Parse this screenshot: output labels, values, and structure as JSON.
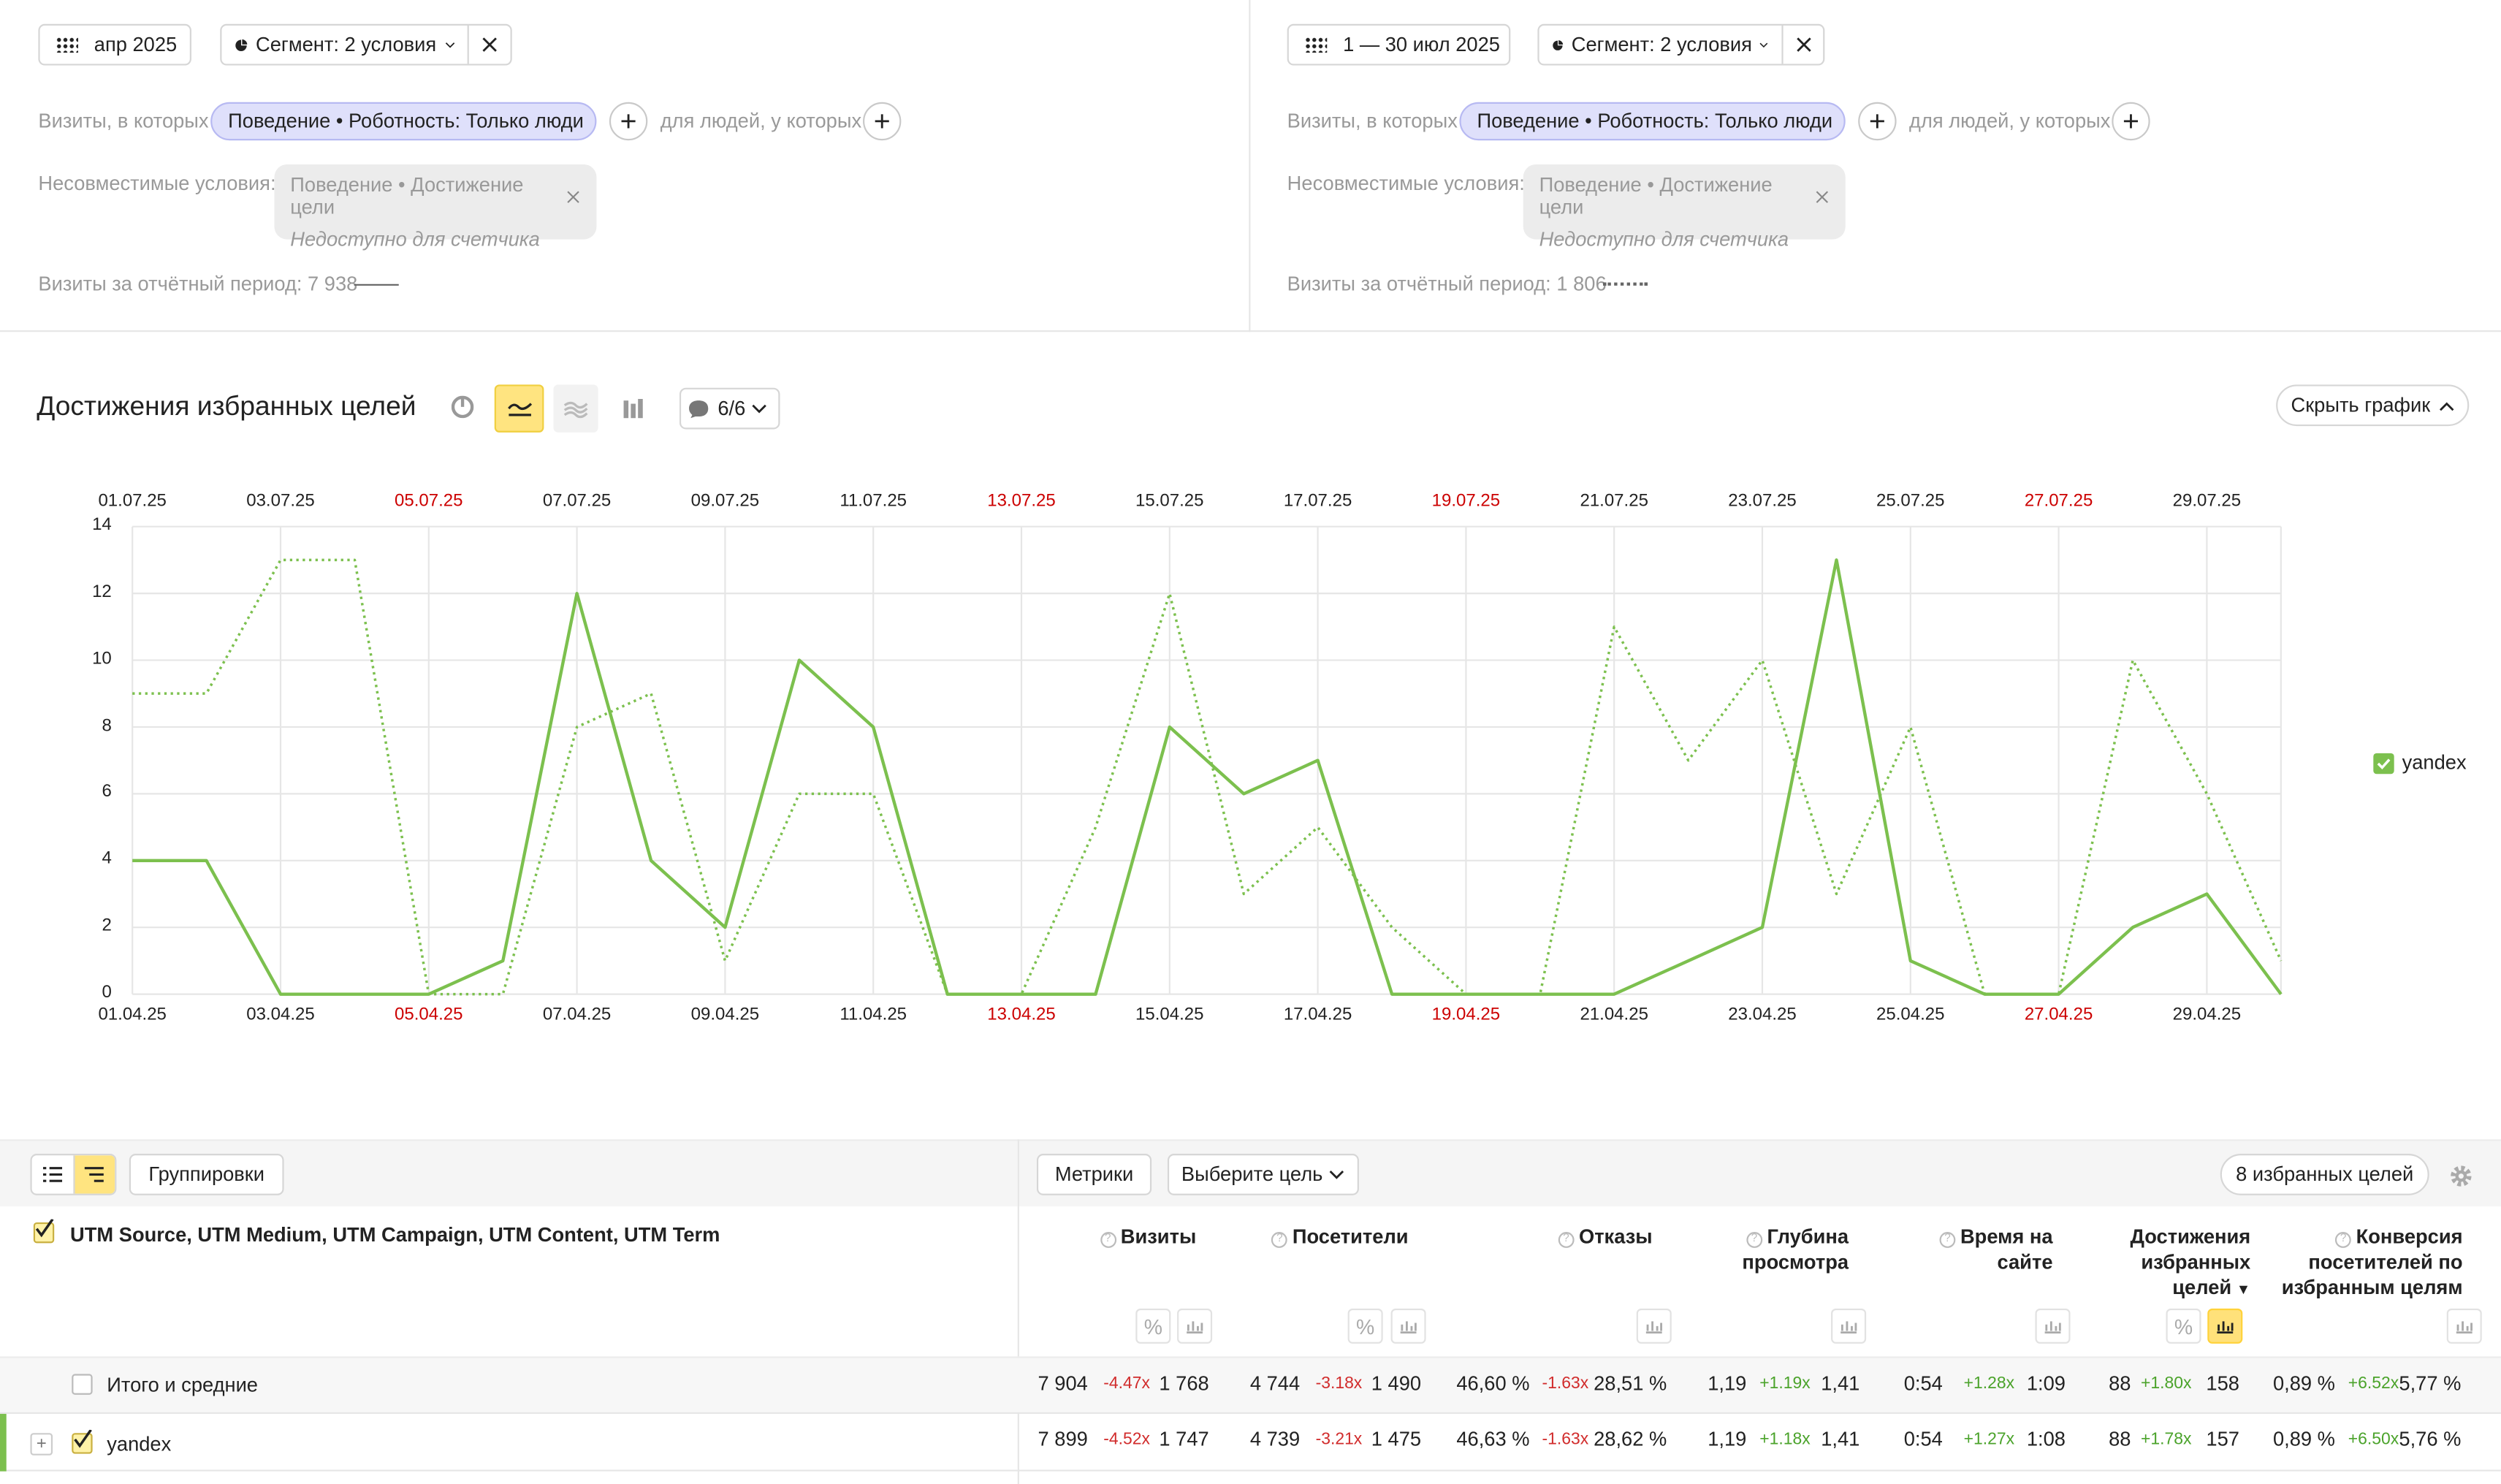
{
  "left_panel": {
    "date_label": "апр 2025",
    "segment_label": "Сегмент: 2 условия",
    "visits_prefix": "Визиты, в которых",
    "condition_chip": "Поведение • Роботность: Только люди",
    "people_label": "для людей, у которых",
    "incompatible_label": "Несовместимые условия:",
    "incompatible_chip": "Поведение • Достижение цели",
    "incompatible_note": "Недоступно для счетчика",
    "visits_summary": "Визиты за отчётный период: 7 938"
  },
  "right_panel": {
    "date_label": "1 — 30 июл 2025",
    "segment_label": "Сегмент: 2 условия",
    "visits_prefix": "Визиты, в которых",
    "condition_chip": "Поведение • Роботность: Только люди",
    "people_label": "для людей, у которых",
    "incompatible_label": "Несовместимые условия:",
    "incompatible_chip": "Поведение • Достижение цели",
    "incompatible_note": "Недоступно для счетчика",
    "visits_summary": "Визиты за отчётный период: 1 806"
  },
  "chart_header": {
    "title": "Достижения избранных целей",
    "annotations_count": "6/6",
    "hide_button": "Скрыть график"
  },
  "chart_data": {
    "type": "line",
    "x_top": [
      "01.07.25",
      "02.07.25",
      "03.07.25",
      "04.07.25",
      "05.07.25",
      "06.07.25",
      "07.07.25",
      "08.07.25",
      "09.07.25",
      "10.07.25",
      "11.07.25",
      "12.07.25",
      "13.07.25",
      "14.07.25",
      "15.07.25",
      "16.07.25",
      "17.07.25",
      "18.07.25",
      "19.07.25",
      "20.07.25",
      "21.07.25",
      "22.07.25",
      "23.07.25",
      "24.07.25",
      "25.07.25",
      "26.07.25",
      "27.07.25",
      "28.07.25",
      "29.07.25",
      "30.07.25"
    ],
    "x_bottom": [
      "01.04.25",
      "02.04.25",
      "03.04.25",
      "04.04.25",
      "05.04.25",
      "06.04.25",
      "07.04.25",
      "08.04.25",
      "09.04.25",
      "10.04.25",
      "11.04.25",
      "12.04.25",
      "13.04.25",
      "14.04.25",
      "15.04.25",
      "16.04.25",
      "17.04.25",
      "18.04.25",
      "19.04.25",
      "20.04.25",
      "21.04.25",
      "22.04.25",
      "23.04.25",
      "24.04.25",
      "25.04.25",
      "26.04.25",
      "27.04.25",
      "28.04.25",
      "29.04.25",
      "30.04.25"
    ],
    "top_tick_labels": [
      "01.07.25",
      "03.07.25",
      "05.07.25",
      "07.07.25",
      "09.07.25",
      "11.07.25",
      "13.07.25",
      "15.07.25",
      "17.07.25",
      "19.07.25",
      "21.07.25",
      "23.07.25",
      "25.07.25",
      "27.07.25",
      "29.07.25"
    ],
    "bottom_tick_labels": [
      "01.04.25",
      "03.04.25",
      "05.04.25",
      "07.04.25",
      "09.04.25",
      "11.04.25",
      "13.04.25",
      "15.04.25",
      "17.04.25",
      "19.04.25",
      "21.04.25",
      "23.04.25",
      "25.04.25",
      "27.04.25",
      "29.04.25"
    ],
    "weekend_ticks": [
      "05.07.25",
      "13.07.25",
      "19.07.25",
      "27.07.25",
      "05.04.25",
      "13.04.25",
      "19.04.25",
      "27.04.25"
    ],
    "yticks": [
      "0",
      "2",
      "4",
      "6",
      "8",
      "10",
      "12",
      "14"
    ],
    "ylim": [
      0,
      14
    ],
    "series": [
      {
        "name": "yandex",
        "period": "апр 2025",
        "style": "solid",
        "color": "#7cc04e",
        "values": [
          4,
          4,
          0,
          0,
          0,
          1,
          12,
          4,
          2,
          10,
          8,
          0,
          0,
          0,
          8,
          6,
          7,
          0,
          0,
          0,
          0,
          1,
          2,
          13,
          1,
          0,
          0,
          2,
          3,
          0
        ]
      },
      {
        "name": "yandex",
        "period": "1 — 30 июл 2025",
        "style": "dotted",
        "color": "#7cc04e",
        "values": [
          9,
          9,
          13,
          13,
          0,
          0,
          8,
          9,
          1,
          6,
          6,
          0,
          0,
          5,
          12,
          3,
          5,
          2,
          0,
          0,
          11,
          7,
          10,
          3,
          8,
          0,
          0,
          10,
          6,
          1
        ]
      }
    ],
    "legend": {
      "label": "yandex",
      "position": "right"
    }
  },
  "table_toolbar": {
    "groupings_button": "Группировки",
    "metrics_button": "Метрики",
    "goal_select": "Выберите цель",
    "goals_button": "8 избранных целей"
  },
  "table": {
    "dimension_header": "UTM Source, UTM Medium, UTM Campaign, UTM Content, UTM Term",
    "columns": {
      "visits": "Визиты",
      "visitors": "Посетители",
      "bounces": "Отказы",
      "depth": "Глубина просмотра",
      "time": "Время на сайте",
      "goals": "Достижения избранных целей",
      "conversion": "Конверсия посетителей по избранным целям"
    },
    "rows": [
      {
        "label": "Итого и средние",
        "visits": [
          "7 904",
          "-4.47x",
          "1 768"
        ],
        "visitors": [
          "4 744",
          "-3.18x",
          "1 490"
        ],
        "bounces": [
          "46,60 %",
          "-1.63x",
          "28,51 %"
        ],
        "depth": [
          "1,19",
          "+1.19x",
          "1,41"
        ],
        "time": [
          "0:54",
          "+1.28x",
          "1:09"
        ],
        "goals": [
          "88",
          "+1.80x",
          "158"
        ],
        "conversion": [
          "0,89 %",
          "+6.52x",
          "5,77 %"
        ]
      },
      {
        "label": "yandex",
        "visits": [
          "7 899",
          "-4.52x",
          "1 747"
        ],
        "visitors": [
          "4 739",
          "-3.21x",
          "1 475"
        ],
        "bounces": [
          "46,63 %",
          "-1.63x",
          "28,62 %"
        ],
        "depth": [
          "1,19",
          "+1.18x",
          "1,41"
        ],
        "time": [
          "0:54",
          "+1.27x",
          "1:08"
        ],
        "goals": [
          "88",
          "+1.78x",
          "157"
        ],
        "conversion": [
          "0,89 %",
          "+6.50x",
          "5,76 %"
        ]
      }
    ]
  }
}
